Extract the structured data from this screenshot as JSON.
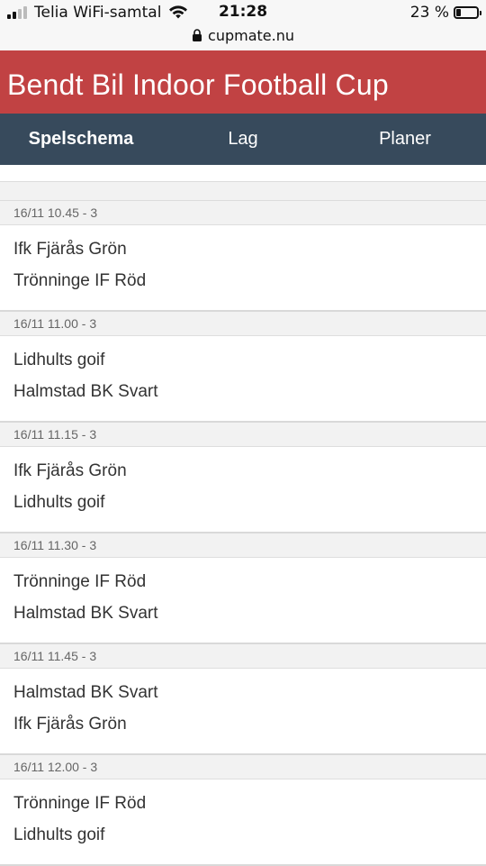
{
  "status_bar": {
    "carrier": "Telia WiFi-samtal",
    "time": "21:28",
    "battery": "23 %",
    "battery_level": 0.23,
    "url": "cupmate.nu"
  },
  "header": {
    "title": "Bendt Bil Indoor Football Cup",
    "color": "#c14243"
  },
  "nav": {
    "color": "#374a5c",
    "tabs": [
      {
        "label": "Spelschema",
        "active": true
      },
      {
        "label": "Lag",
        "active": false
      },
      {
        "label": "Planer",
        "active": false
      }
    ]
  },
  "matches": [
    {
      "time": "16/11 10.45 - 3",
      "home": "Ifk Fjärås Grön",
      "away": "Trönninge IF Röd"
    },
    {
      "time": "16/11 11.00 - 3",
      "home": "Lidhults goif",
      "away": "Halmstad BK Svart"
    },
    {
      "time": "16/11 11.15 - 3",
      "home": "Ifk Fjärås Grön",
      "away": "Lidhults goif"
    },
    {
      "time": "16/11 11.30 - 3",
      "home": "Trönninge IF Röd",
      "away": "Halmstad BK Svart"
    },
    {
      "time": "16/11 11.45 - 3",
      "home": "Halmstad BK Svart",
      "away": "Ifk Fjärås Grön"
    },
    {
      "time": "16/11 12.00 - 3",
      "home": "Trönninge IF Röd",
      "away": "Lidhults goif"
    }
  ]
}
